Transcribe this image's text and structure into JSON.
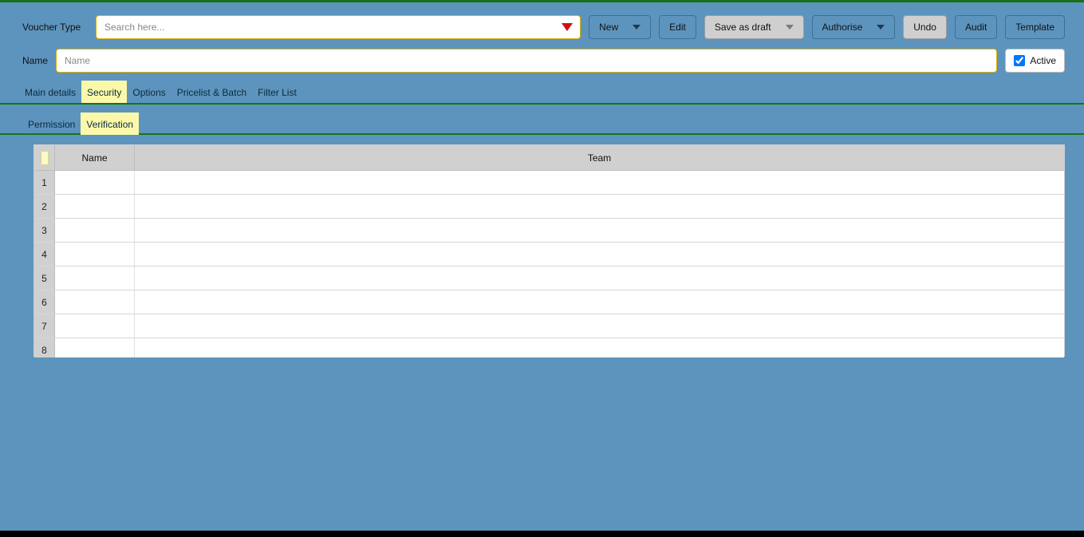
{
  "toolbar": {
    "voucher_type_label": "Voucher Type",
    "search_placeholder": "Search here...",
    "new_label": "New",
    "edit_label": "Edit",
    "save_draft_label": "Save as draft",
    "authorise_label": "Authorise",
    "undo_label": "Undo",
    "audit_label": "Audit",
    "template_label": "Template"
  },
  "name_row": {
    "label": "Name",
    "placeholder": "Name",
    "active_label": "Active",
    "active_checked": true
  },
  "tabs": [
    {
      "label": "Main details",
      "active": false
    },
    {
      "label": "Security",
      "active": true
    },
    {
      "label": "Options",
      "active": false
    },
    {
      "label": "Pricelist & Batch",
      "active": false
    },
    {
      "label": "Filter List",
      "active": false
    }
  ],
  "subtabs": [
    {
      "label": "Permission",
      "active": false
    },
    {
      "label": "Verification",
      "active": true
    }
  ],
  "table": {
    "columns": {
      "name": "Name",
      "team": "Team"
    },
    "rows": [
      {
        "num": "1",
        "name": "",
        "team": ""
      },
      {
        "num": "2",
        "name": "",
        "team": ""
      },
      {
        "num": "3",
        "name": "",
        "team": ""
      },
      {
        "num": "4",
        "name": "",
        "team": ""
      },
      {
        "num": "5",
        "name": "",
        "team": ""
      },
      {
        "num": "6",
        "name": "",
        "team": ""
      },
      {
        "num": "7",
        "name": "",
        "team": ""
      },
      {
        "num": "8",
        "name": "",
        "team": ""
      }
    ]
  }
}
